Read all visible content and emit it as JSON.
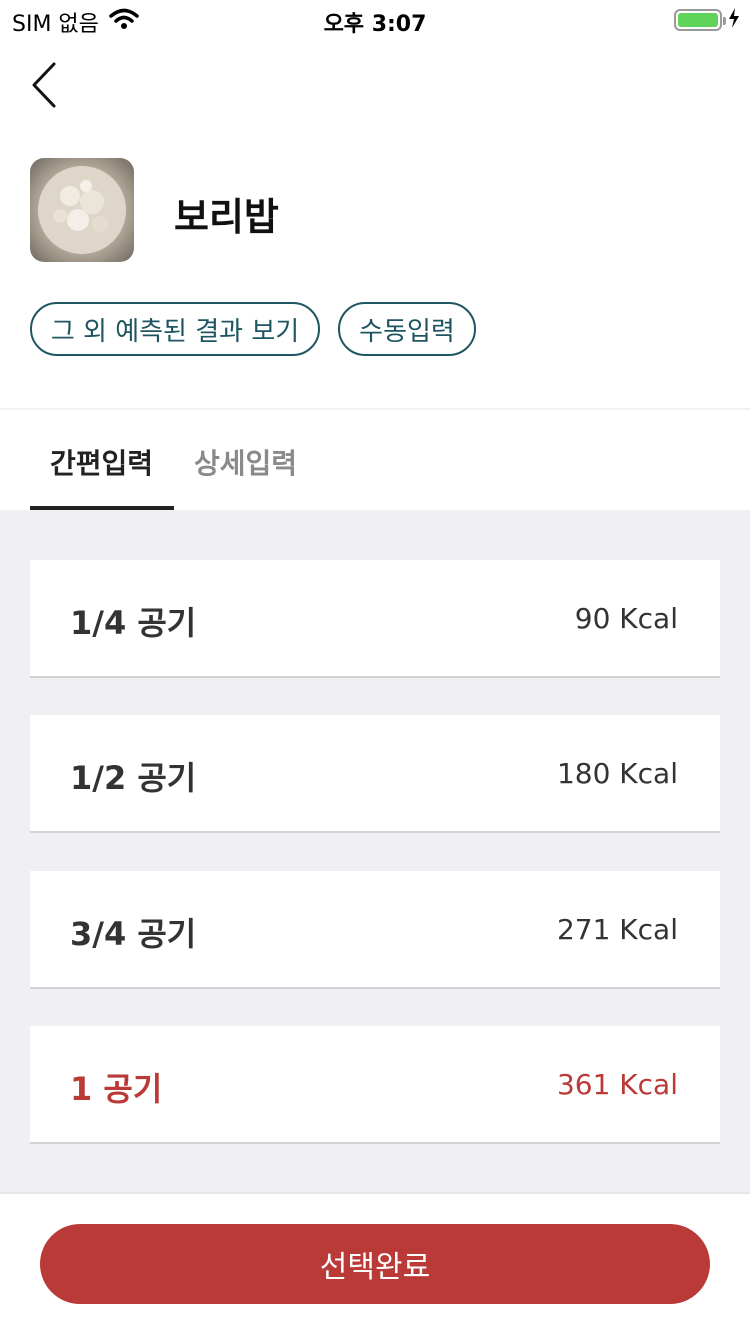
{
  "status_bar": {
    "carrier": "SIM 없음",
    "time": "오후 3:07",
    "battery_level": 1.0,
    "battery_color": "#5fd35a"
  },
  "header": {
    "back_icon": "chevron-left-icon",
    "food_name": "보리밥"
  },
  "chips": {
    "more_results": "그 외 예측된 결과 보기",
    "manual_input": "수동입력"
  },
  "tabs": [
    {
      "label": "간편입력",
      "active": true
    },
    {
      "label": "상세입력",
      "active": false
    }
  ],
  "portions": [
    {
      "label": "1/4 공기",
      "kcal": "90 Kcal",
      "selected": false
    },
    {
      "label": "1/2 공기",
      "kcal": "180 Kcal",
      "selected": false
    },
    {
      "label": "3/4 공기",
      "kcal": "271 Kcal",
      "selected": false
    },
    {
      "label": "1 공기",
      "kcal": "361 Kcal",
      "selected": true
    }
  ],
  "confirm_label": "선택완료",
  "colors": {
    "accent": "#b93a37",
    "chip_border": "#1f5561",
    "list_background": "#efeff4"
  }
}
